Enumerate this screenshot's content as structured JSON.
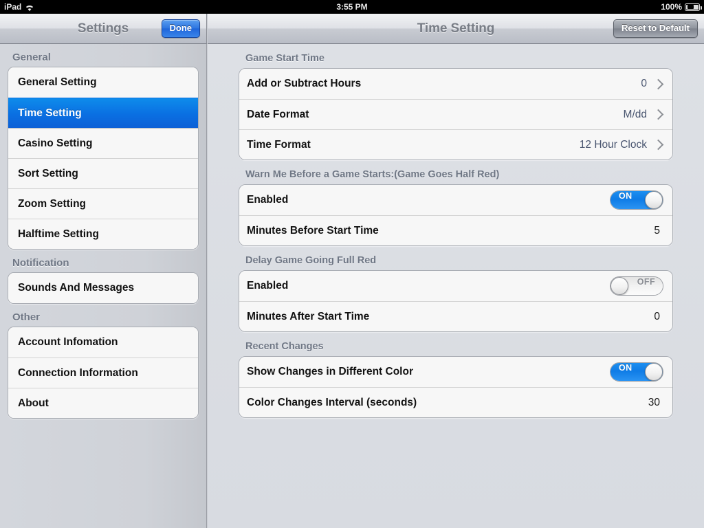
{
  "statusbar": {
    "device": "iPad",
    "wifi_icon": "wifi-icon",
    "time": "3:55 PM",
    "battery_percent": "100%",
    "battery_icon": "battery-charging-icon"
  },
  "sidebar_nav": {
    "title": "Settings",
    "done_label": "Done"
  },
  "main_nav": {
    "title": "Time Setting",
    "reset_label": "Reset to Default"
  },
  "sidebar": {
    "sections": [
      {
        "header": "General",
        "items": [
          {
            "label": "General Setting",
            "selected": false
          },
          {
            "label": "Time Setting",
            "selected": true
          },
          {
            "label": "Casino Setting",
            "selected": false
          },
          {
            "label": "Sort Setting",
            "selected": false
          },
          {
            "label": "Zoom Setting",
            "selected": false
          },
          {
            "label": "Halftime Setting",
            "selected": false
          }
        ]
      },
      {
        "header": "Notification",
        "items": [
          {
            "label": "Sounds And Messages",
            "selected": false
          }
        ]
      },
      {
        "header": "Other",
        "items": [
          {
            "label": "Account Infomation",
            "selected": false
          },
          {
            "label": "Connection Information",
            "selected": false
          },
          {
            "label": "About",
            "selected": false
          }
        ]
      }
    ]
  },
  "main": {
    "sections": [
      {
        "header": "Game Start Time",
        "rows": [
          {
            "label": "Add or Subtract Hours",
            "type": "disclosure",
            "value": "0"
          },
          {
            "label": "Date Format",
            "type": "disclosure",
            "value": "M/dd"
          },
          {
            "label": "Time Format",
            "type": "disclosure",
            "value": "12 Hour Clock"
          }
        ]
      },
      {
        "header": "Warn Me Before a Game Starts:(Game Goes Half Red)",
        "rows": [
          {
            "label": "Enabled",
            "type": "toggle",
            "value": "ON"
          },
          {
            "label": "Minutes Before Start Time",
            "type": "value",
            "value": "5"
          }
        ]
      },
      {
        "header": "Delay Game Going Full Red",
        "rows": [
          {
            "label": "Enabled",
            "type": "toggle",
            "value": "OFF"
          },
          {
            "label": "Minutes After Start Time",
            "type": "value",
            "value": "0"
          }
        ]
      },
      {
        "header": "Recent Changes",
        "rows": [
          {
            "label": "Show Changes in Different Color",
            "type": "toggle",
            "value": "ON"
          },
          {
            "label": "Color Changes Interval (seconds)",
            "type": "value",
            "value": "30"
          }
        ]
      }
    ]
  },
  "colors": {
    "accent_blue": "#0d7fe8",
    "section_header": "#6f7785",
    "value_text": "#4a5670",
    "panel_bg": "#d8dbe1"
  }
}
